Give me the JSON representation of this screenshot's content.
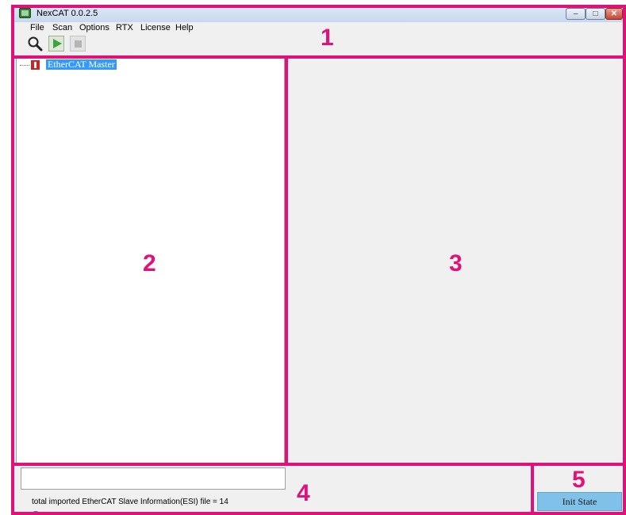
{
  "window": {
    "title": "NexCAT 0.0.2.5"
  },
  "menu": {
    "file": "File",
    "scan": "Scan",
    "options": "Options",
    "rtx": "RTX",
    "license": "License",
    "help": "Help"
  },
  "toolbar": {
    "icons": [
      "search-icon",
      "play-icon",
      "stop-icon"
    ]
  },
  "tree": {
    "root_label": "EtherCAT Master"
  },
  "status": {
    "message": "total imported EtherCAT Slave Information(ESI) file = 14"
  },
  "init_button": {
    "label": "Init State"
  },
  "callouts": {
    "n1": "1",
    "n2": "2",
    "n3": "3",
    "n4": "4",
    "n5": "5"
  },
  "colors": {
    "accent": "#e0127a",
    "button": "#7fc1e8",
    "selection": "#3399ff"
  }
}
